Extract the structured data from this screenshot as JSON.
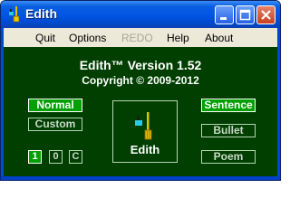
{
  "window": {
    "title": "Edith"
  },
  "menu": [
    {
      "label": "Quit",
      "enabled": true
    },
    {
      "label": "Options",
      "enabled": true
    },
    {
      "label": "REDO",
      "enabled": false
    },
    {
      "label": "Help",
      "enabled": true
    },
    {
      "label": "About",
      "enabled": true
    }
  ],
  "header": {
    "version_line": "Edith™  Version 1.52",
    "copyright_line": "Copyright © 2009-2012"
  },
  "modes": {
    "normal": "Normal",
    "custom": "Custom",
    "active": "Normal"
  },
  "counters": {
    "one": "1",
    "zero": "0",
    "c": "C"
  },
  "center": {
    "label": "Edith",
    "icon": "broom-icon"
  },
  "styles": {
    "sentence": "Sentence",
    "bullet": "Bullet",
    "poem": "Poem",
    "active": "Sentence"
  },
  "colors": {
    "background": "#003f00",
    "active_button": "#00a000",
    "titlebar": "#0054e3"
  }
}
